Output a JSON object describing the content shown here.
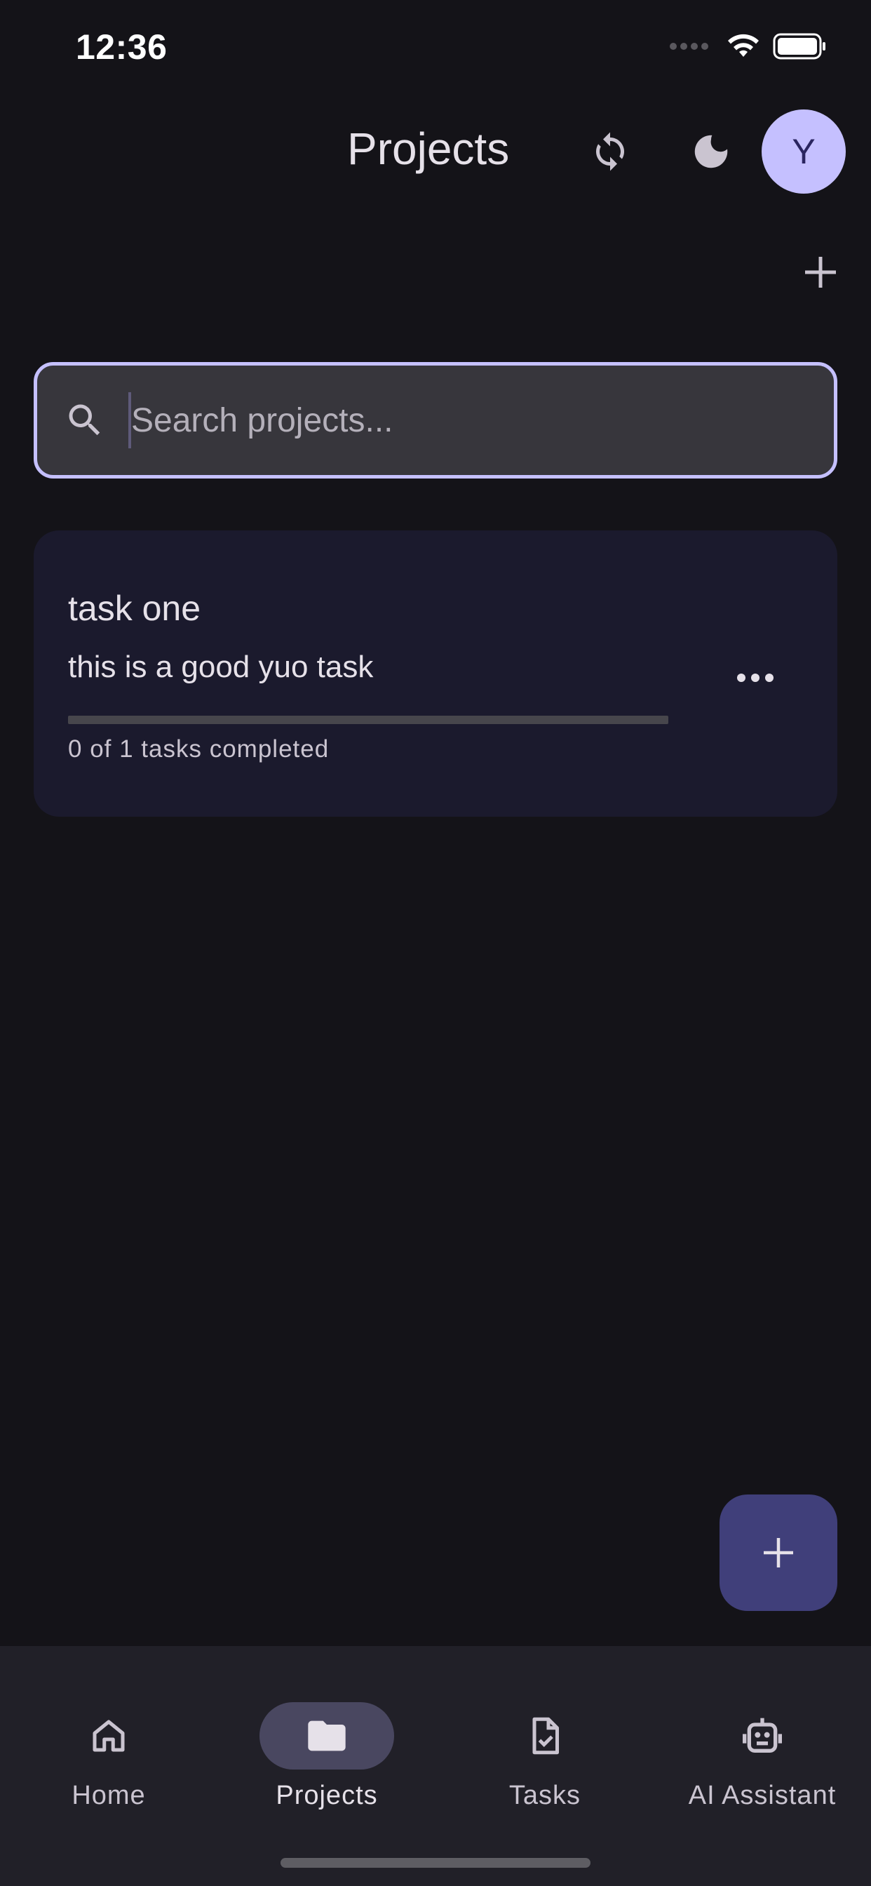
{
  "status_bar": {
    "time": "12:36"
  },
  "header": {
    "title": "Projects",
    "avatar_letter": "Y",
    "sync_icon": "sync-icon",
    "theme_icon": "moon-icon",
    "add_icon": "plus-icon"
  },
  "search": {
    "placeholder": "Search projects...",
    "value": ""
  },
  "projects": [
    {
      "title": "task one",
      "description": "this is a good yuo task",
      "progress_fraction": 0,
      "status": "0 of 1 tasks completed"
    }
  ],
  "nav": {
    "items": [
      {
        "label": "Home",
        "icon": "home-icon"
      },
      {
        "label": "Projects",
        "icon": "folder-icon",
        "active": true
      },
      {
        "label": "Tasks",
        "icon": "task-document-icon"
      },
      {
        "label": "AI Assistant",
        "icon": "robot-icon"
      }
    ]
  },
  "colors": {
    "background": "#141318",
    "accent": "#c5c0ff",
    "card": "#1b1a2d",
    "fab": "#403f7a",
    "nav_background": "#212028",
    "nav_active_pill": "#494760"
  }
}
